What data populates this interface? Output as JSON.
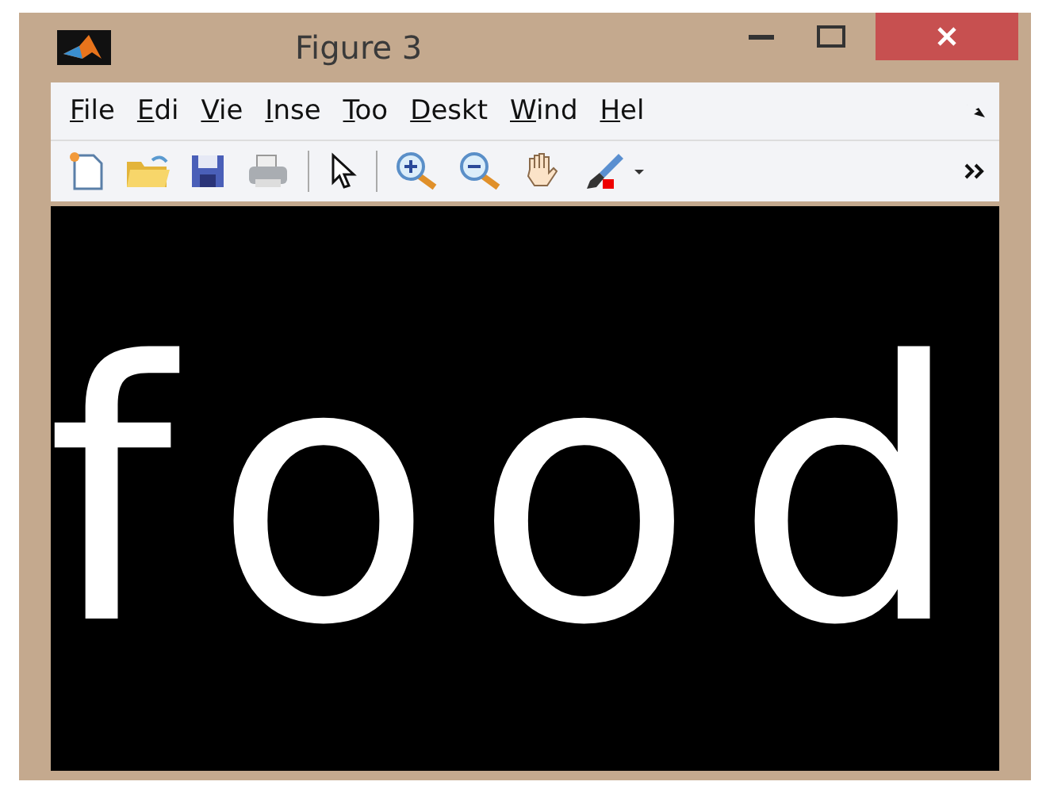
{
  "window": {
    "title": "Figure 3"
  },
  "menu": [
    "File",
    "Edi",
    "Vie",
    "Inse",
    "Too",
    "Deskt",
    "Wind",
    "Hel"
  ],
  "toolbar": [
    {
      "kind": "new"
    },
    {
      "kind": "open"
    },
    {
      "kind": "save"
    },
    {
      "kind": "print"
    },
    {
      "kind": "sep"
    },
    {
      "kind": "pointer"
    },
    {
      "kind": "sep"
    },
    {
      "kind": "zoomin"
    },
    {
      "kind": "zoomout"
    },
    {
      "kind": "pan"
    },
    {
      "kind": "brush"
    }
  ],
  "figure": {
    "text": "food"
  }
}
